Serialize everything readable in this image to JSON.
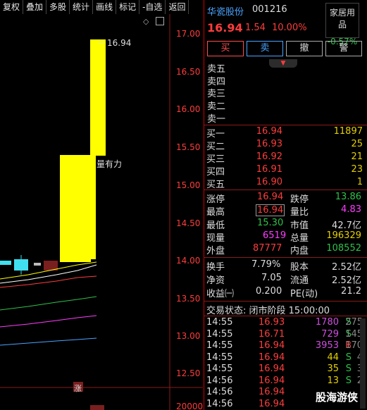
{
  "toolbar": [
    "复权",
    "叠加",
    "多股",
    "统计",
    "画线",
    "标记",
    "-自选",
    "返回"
  ],
  "chart": {
    "price_axis": [
      "17.00",
      "16.50",
      "16.00",
      "15.50",
      "15.00",
      "14.50",
      "14.00",
      "13.50",
      "13.00",
      "12.50"
    ],
    "volume_label": "20000",
    "peak_label": "16.94",
    "annotation": "量有力",
    "marker": "涨",
    "colors": {
      "bar": "#ffff00",
      "up": "#ff3c3c",
      "axis": "#ff3c3c"
    }
  },
  "stock": {
    "name": "华瓷股份",
    "code": "001216",
    "price": "16.94",
    "change": "1.54",
    "pct": "10.00%",
    "industry": "家居用品",
    "industry_chg": "-0.57%"
  },
  "trade_buttons": [
    "买",
    "卖",
    "撤",
    "警"
  ],
  "sell_levels": [
    "卖五",
    "卖四",
    "卖三",
    "卖二",
    "卖一"
  ],
  "buy_levels": [
    {
      "label": "买一",
      "price": "16.94",
      "vol": "11897"
    },
    {
      "label": "买二",
      "price": "16.93",
      "vol": "25"
    },
    {
      "label": "买三",
      "price": "16.92",
      "vol": "21"
    },
    {
      "label": "买四",
      "price": "16.91",
      "vol": "23"
    },
    {
      "label": "买五",
      "price": "16.90",
      "vol": "1"
    }
  ],
  "stats1": {
    "zt_l": "涨停",
    "zt": "16.94",
    "dt_l": "跌停",
    "dt": "13.86",
    "high_l": "最高",
    "high": "16.94",
    "lb_l": "量比",
    "lb": "4.83",
    "low_l": "最低",
    "low": "15.30",
    "sz_l": "市值",
    "sz": "42.7亿",
    "xl_l": "现量",
    "xl": "6519",
    "zl_l": "总量",
    "zl": "196329",
    "wp_l": "外盘",
    "wp": "87777",
    "np_l": "内盘",
    "np": "108552"
  },
  "stats2": {
    "hs_l": "换手",
    "hs": "7.79%",
    "gb_l": "股本",
    "gb": "2.52亿",
    "jz_l": "净资",
    "jz": "7.05",
    "lt_l": "流通",
    "lt": "2.52亿",
    "sy_l": "收益㈠",
    "sy": "0.200",
    "pe_l": "PE(动)",
    "pe": "21.2"
  },
  "trade_status": "交易状态: 闭市阶段 15:00:00",
  "ticks": [
    {
      "t": "14:55",
      "p": "16.93",
      "v": "1780",
      "d": "S",
      "n": "275",
      "vc": "#d04de0",
      "dc": "#2ec24a"
    },
    {
      "t": "14:55",
      "p": "16.71",
      "v": "729",
      "d": "S",
      "n": "145",
      "vc": "#d04de0",
      "dc": "#2ec24a"
    },
    {
      "t": "14:55",
      "p": "16.94",
      "v": "3953",
      "d": "B",
      "n": "170",
      "vc": "#d04de0",
      "dc": "#ff3c3c"
    },
    {
      "t": "14:55",
      "p": "16.94",
      "v": "44",
      "d": "S",
      "n": "4",
      "vc": "#e5cf00",
      "dc": "#2ec24a"
    },
    {
      "t": "14:55",
      "p": "16.94",
      "v": "35",
      "d": "S",
      "n": "3",
      "vc": "#e5cf00",
      "dc": "#2ec24a"
    },
    {
      "t": "14:56",
      "p": "16.94",
      "v": "13",
      "d": "S",
      "n": "2",
      "vc": "#e5cf00",
      "dc": "#2ec24a"
    },
    {
      "t": "14:56",
      "p": "16.94",
      "v": "",
      "d": "",
      "n": "",
      "vc": "#e5cf00",
      "dc": "#2ec24a"
    },
    {
      "t": "14:56",
      "p": "16.94",
      "v": "",
      "d": "",
      "n": "",
      "vc": "#e5cf00",
      "dc": "#2ec24a"
    }
  ],
  "watermark": "股海游侠"
}
